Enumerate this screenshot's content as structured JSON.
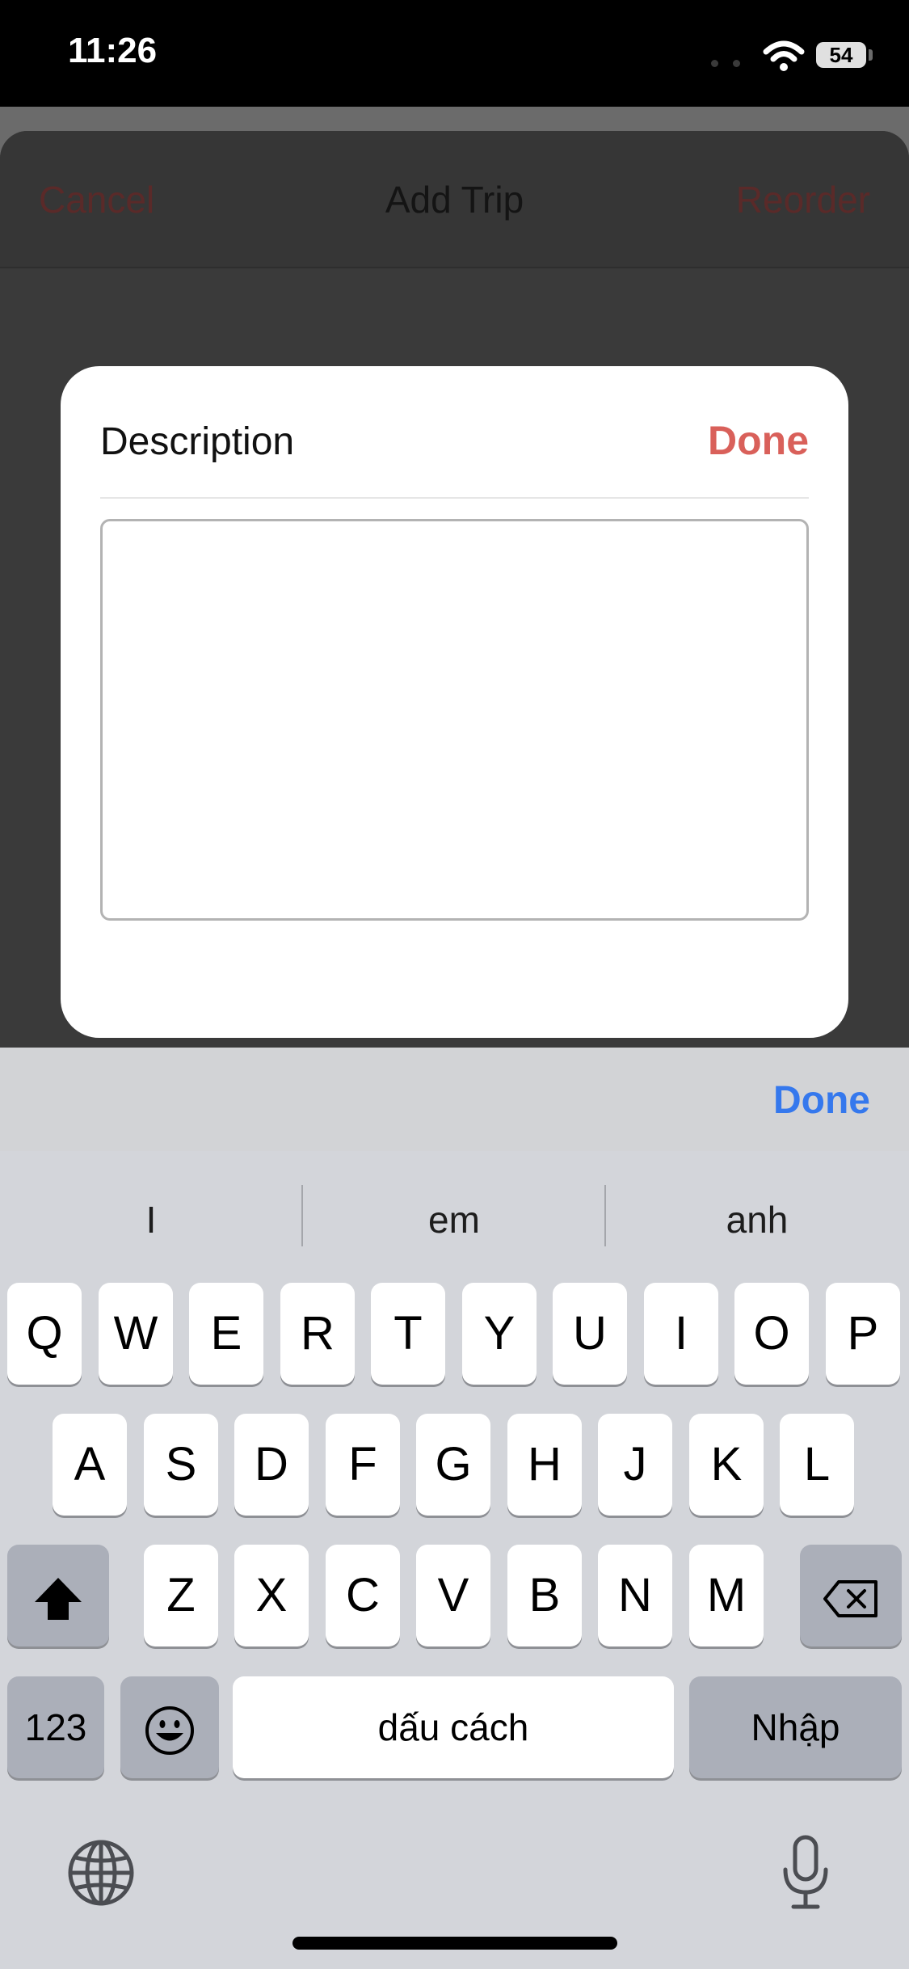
{
  "status_bar": {
    "time": "11:26",
    "battery": "54"
  },
  "sheet": {
    "cancel": "Cancel",
    "title": "Add Trip",
    "reorder": "Reorder"
  },
  "dialog": {
    "title": "Description",
    "done": "Done",
    "text_value": ""
  },
  "keyboard_toolbar": {
    "done": "Done"
  },
  "keyboard": {
    "suggestions": [
      "I",
      "em",
      "anh"
    ],
    "row1": [
      "Q",
      "W",
      "E",
      "R",
      "T",
      "Y",
      "U",
      "I",
      "O",
      "P"
    ],
    "row2": [
      "A",
      "S",
      "D",
      "F",
      "G",
      "H",
      "J",
      "K",
      "L"
    ],
    "row3": [
      "Z",
      "X",
      "C",
      "V",
      "B",
      "N",
      "M"
    ],
    "numbers": "123",
    "space": "dấu cách",
    "return": "Nhập"
  },
  "colors": {
    "accent_red": "#d9605a",
    "accent_blue": "#3578ed"
  },
  "icons": [
    "wifi-icon",
    "shift-icon",
    "backspace-icon",
    "emoji-icon",
    "globe-icon",
    "microphone-icon"
  ]
}
